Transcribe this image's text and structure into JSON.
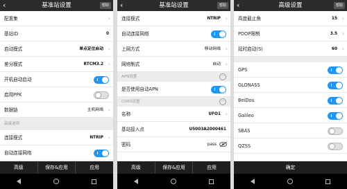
{
  "panel1": {
    "back_icon": "‹",
    "title": "基准站设置",
    "help": "帮助",
    "rows": [
      {
        "label": "配置集",
        "value": ""
      },
      {
        "label": "基站ID",
        "value": "0"
      },
      {
        "label": "启动模式",
        "value": "单点定位启动"
      },
      {
        "label": "差分模式",
        "value": "RTCM3.2"
      },
      {
        "label": "开机自动启动",
        "toggle": true
      },
      {
        "label": "启用PPK",
        "toggle": false
      },
      {
        "label": "数据链",
        "value": "主机网络"
      },
      {
        "label": "高级选项"
      },
      {
        "label": "连接模式",
        "value": "NTRIP"
      },
      {
        "label": "自动连接网络",
        "toggle": true
      }
    ],
    "actions": [
      "高级",
      "保存&应用",
      "应用"
    ]
  },
  "panel2": {
    "back_icon": "‹",
    "title": "基准站设置",
    "help": "帮助",
    "rows": [
      {
        "label": "连接模式",
        "value": "NTRIP"
      },
      {
        "label": "自动连接网络",
        "toggle": true
      },
      {
        "label": "上网方式",
        "value": "移动网络"
      },
      {
        "label": "网络制式",
        "value": "自动"
      },
      {
        "label": "APN设置"
      },
      {
        "label": "是否使用自动APN",
        "toggle": true
      },
      {
        "label": "CORS设置"
      },
      {
        "label": "名称",
        "value": "UFO1"
      },
      {
        "label": "基站接入点",
        "value": "U5003A2000461"
      },
      {
        "label": "密码",
        "value": "pass"
      }
    ],
    "more_icon": "···",
    "actions": [
      "高级",
      "保存&应用",
      "应用"
    ]
  },
  "panel3": {
    "back_icon": "‹",
    "title": "高级设置",
    "help": "帮助",
    "rows": [
      {
        "label": "高度截止角",
        "value": "15"
      },
      {
        "label": "PDOP限制",
        "value": "3.5"
      },
      {
        "label": "延时启动(S)",
        "value": "60"
      },
      {
        "label": "GPS",
        "toggle": true
      },
      {
        "label": "GLONASS",
        "toggle": true
      },
      {
        "label": "BeiDou",
        "toggle": true
      },
      {
        "label": "Galileo",
        "toggle": true
      },
      {
        "label": "SBAS",
        "toggle": false
      },
      {
        "label": "QZSS",
        "toggle": false
      }
    ],
    "actions": [
      "确定"
    ]
  },
  "chevron": "›",
  "colors": {
    "accent": "#2196f3",
    "header": "#2b2b2b",
    "actionbar": "#1f1f1f"
  }
}
